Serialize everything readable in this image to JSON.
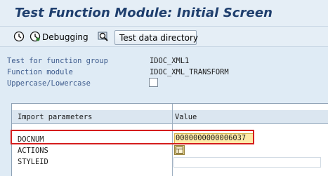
{
  "window": {
    "title": "Test Function Module: Initial Screen"
  },
  "toolbar": {
    "execute_icon": "clock-execute-icon",
    "debugging_icon": "clock-debug-icon",
    "debugging_label": "Debugging",
    "search_icon": "search-icon",
    "test_data_directory_label": "Test data directory"
  },
  "header_fields": [
    {
      "label": "Test for function group",
      "value": "IDOC_XML1"
    },
    {
      "label": "Function module",
      "value": "IDOC_XML_TRANSFORM"
    },
    {
      "label": "Uppercase/Lowercase",
      "checked": false
    }
  ],
  "params_table": {
    "col_import": "Import parameters",
    "col_value": "Value",
    "rows": [
      {
        "name": "DOCNUM",
        "value": "0000000000006037"
      },
      {
        "name": "ACTIONS",
        "value_icon": "table-icon"
      },
      {
        "name": "STYLEID",
        "value": ""
      }
    ]
  },
  "colors": {
    "background": "#dfebf5",
    "title_text": "#1f3f6e",
    "label_text": "#3c5a8c",
    "highlight": "#d51d1d",
    "docnum_bg": "#fde9a8"
  }
}
